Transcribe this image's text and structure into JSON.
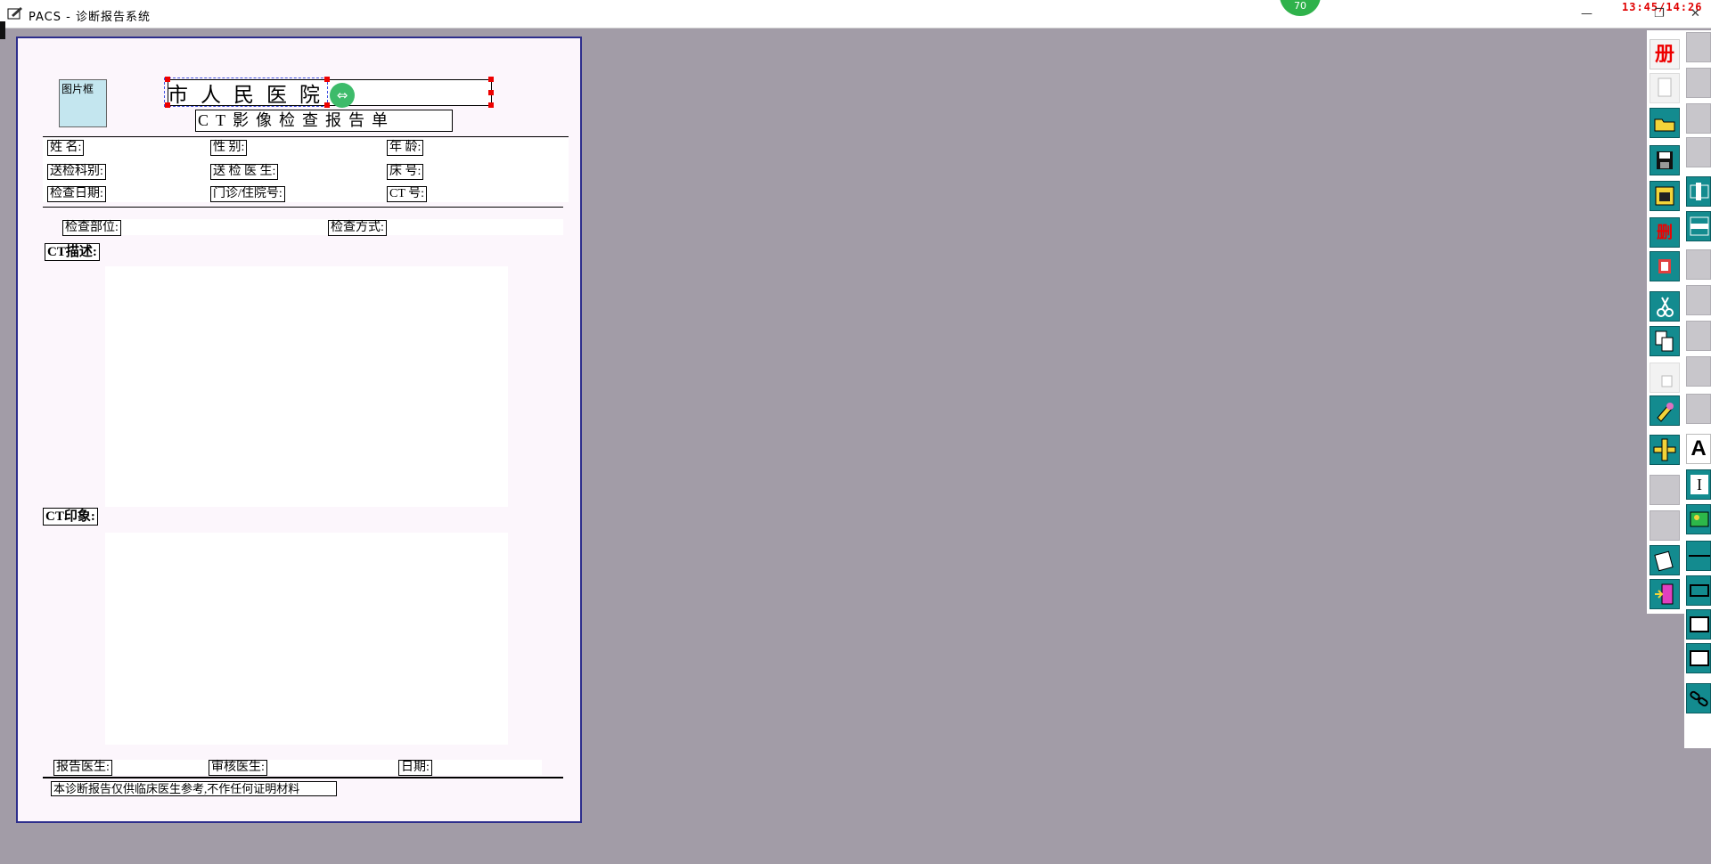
{
  "window": {
    "title": "PACS - 诊断报告系统",
    "clock": "13:45/14:26",
    "badge": "70",
    "min_label": "—",
    "restore_label": "❐",
    "close_label": "✕"
  },
  "report": {
    "photo_label": "图片框",
    "hospital_name": "市人民医院",
    "report_title": "CT影像检查报告单",
    "fields_row1": [
      "姓    名:",
      "性      别:",
      "年    龄:"
    ],
    "fields_row2": [
      "送检科别:",
      "送 检 医 生:",
      "床    号:"
    ],
    "fields_row3": [
      "检查日期:",
      "门诊/住院号:",
      "CT    号:"
    ],
    "exam_part": "检查部位:",
    "exam_method": "检查方式:",
    "ct_desc_title": "CT描述:",
    "ct_impression_title": "CT印象:",
    "report_doctor": "报告医生:",
    "review_doctor": "审核医生:",
    "date": "日期:",
    "disclaimer": "本诊断报告仅供临床医生参考,不作任何证明材料"
  },
  "toolbar": {
    "top_glyph": "册",
    "delete_glyph": "删",
    "text_tool_glyph": "A",
    "text_cursor_glyph": "I"
  }
}
